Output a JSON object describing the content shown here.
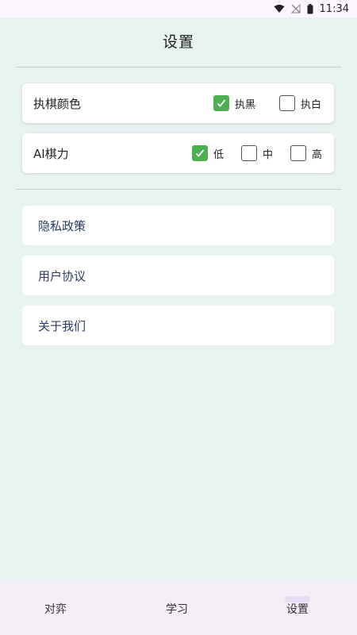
{
  "status_bar": {
    "time": "11:34"
  },
  "page": {
    "title": "设置"
  },
  "settings": {
    "color": {
      "label": "执棋颜色",
      "options": [
        {
          "label": "执黑",
          "checked": true
        },
        {
          "label": "执白",
          "checked": false
        }
      ]
    },
    "ai": {
      "label": "AI棋力",
      "options": [
        {
          "label": "低",
          "checked": true
        },
        {
          "label": "中",
          "checked": false
        },
        {
          "label": "高",
          "checked": false
        }
      ]
    }
  },
  "links": [
    {
      "label": "隐私政策"
    },
    {
      "label": "用户协议"
    },
    {
      "label": "关于我们"
    }
  ],
  "bottom_nav": {
    "items": [
      {
        "label": "对弈"
      },
      {
        "label": "学习"
      },
      {
        "label": "设置"
      }
    ],
    "active_index": 2
  },
  "colors": {
    "accent_check": "#4caf50",
    "background": "#e8f2f1",
    "link_text": "#2b3b63"
  }
}
